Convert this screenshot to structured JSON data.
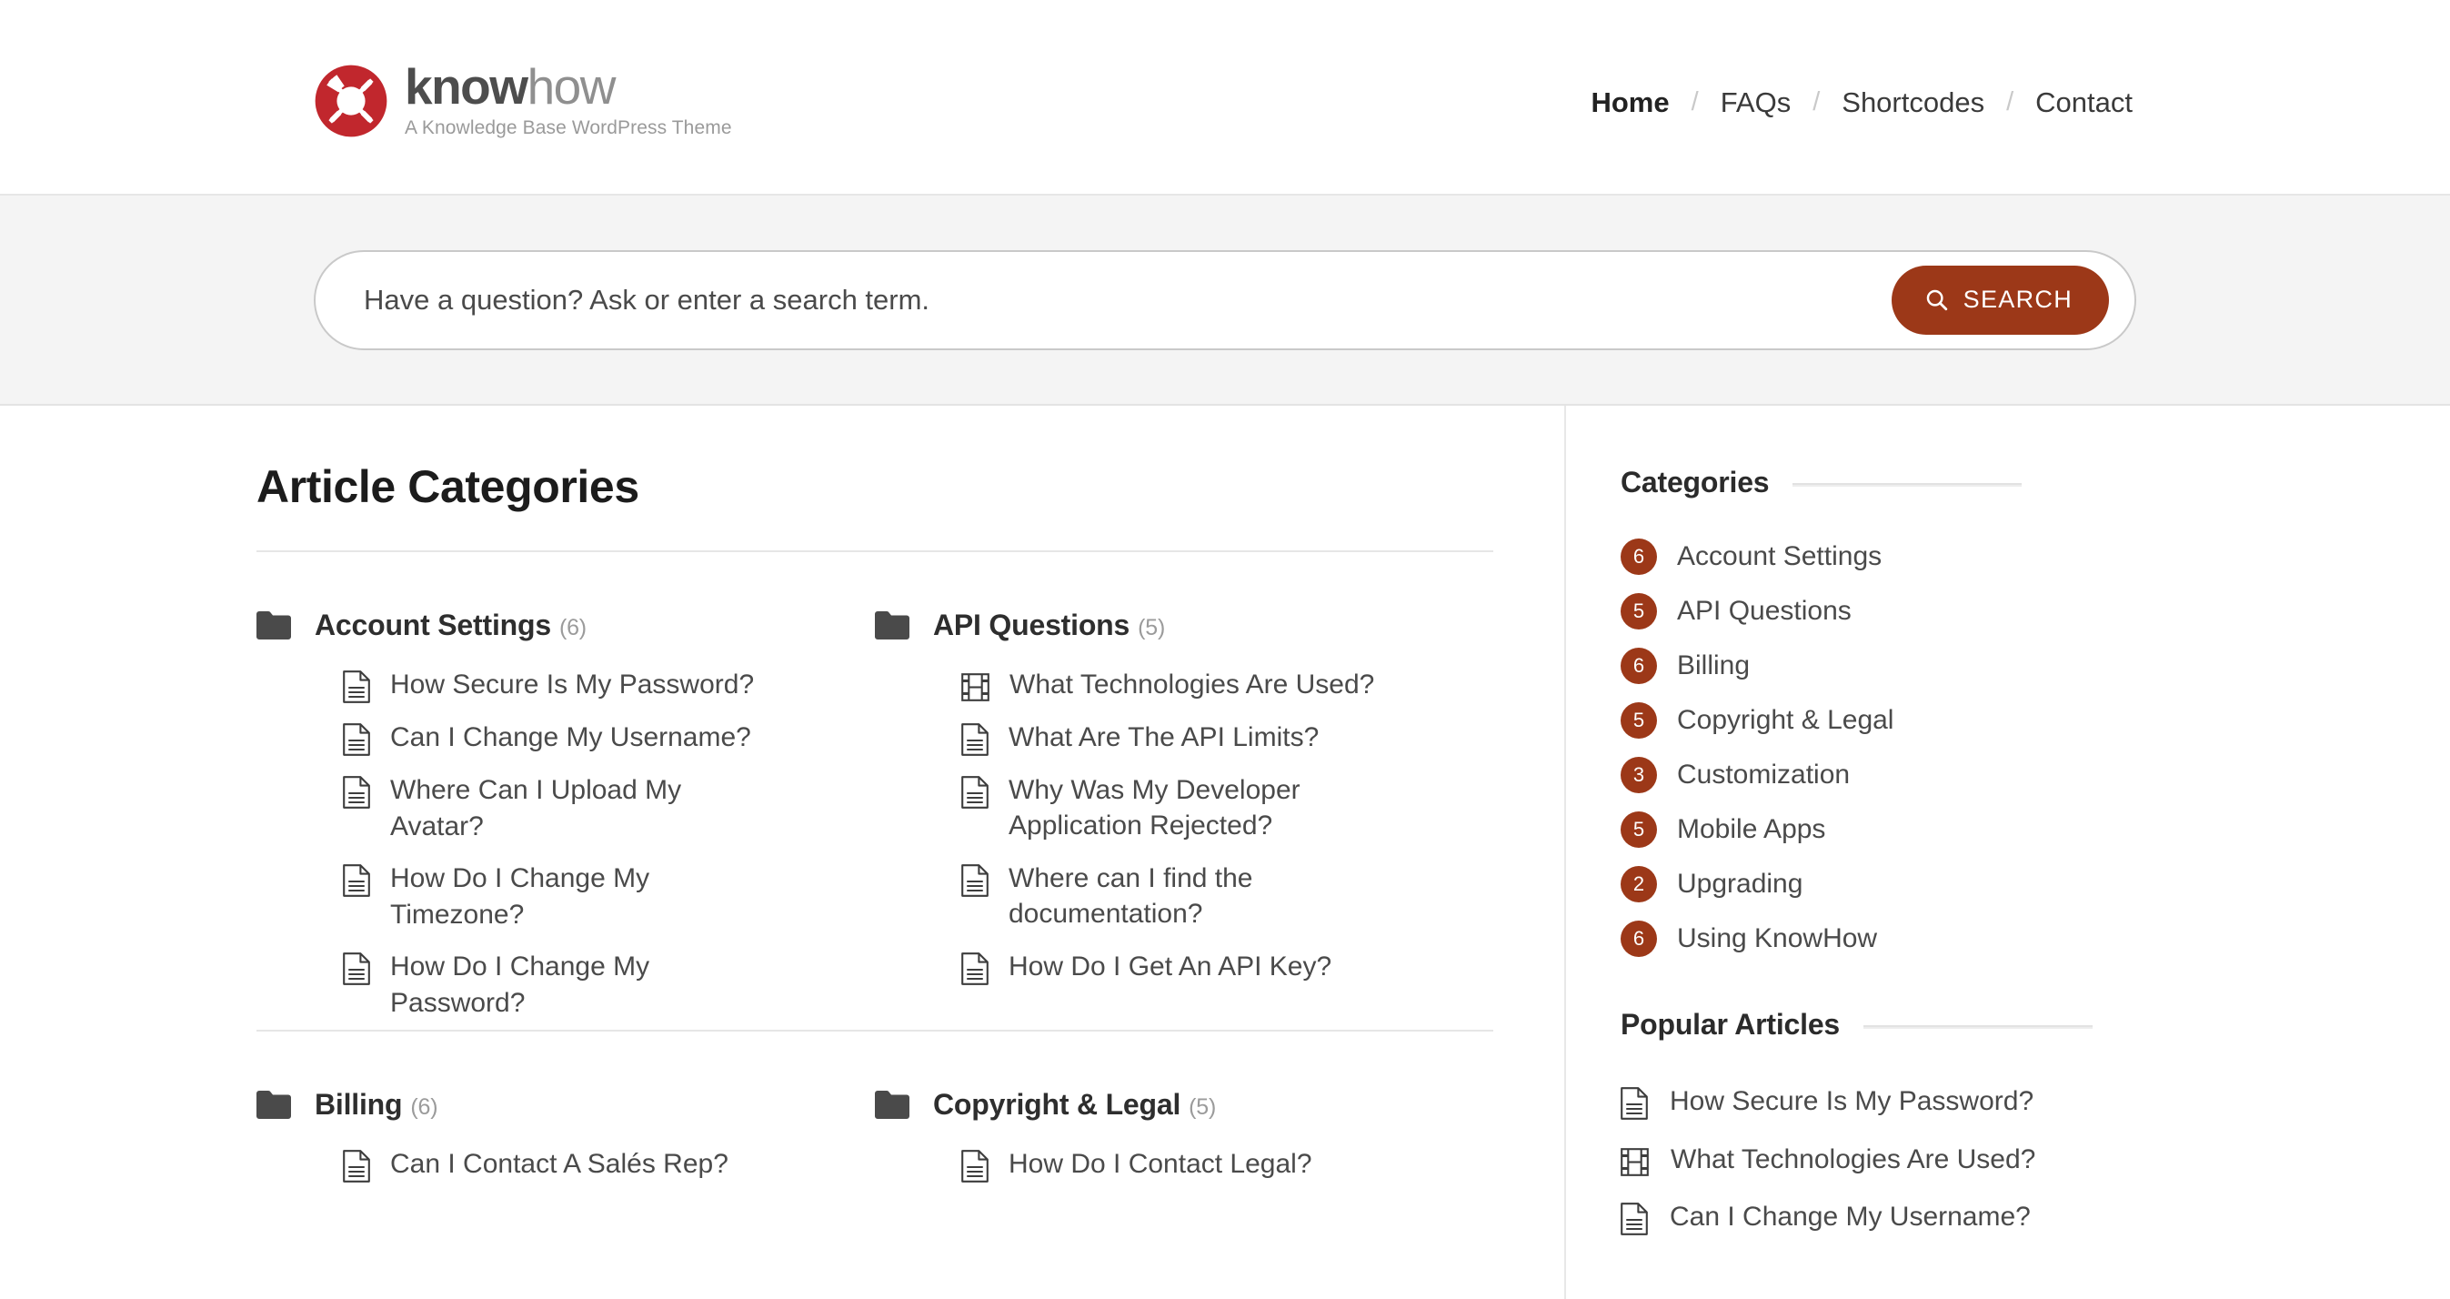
{
  "header": {
    "logo": {
      "icon": "lifebuoy-icon",
      "word_bold": "know",
      "word_light": "how",
      "tagline": "A Knowledge Base WordPress Theme",
      "brand_red": "#c1272d"
    },
    "nav": {
      "separator": "/",
      "items": [
        {
          "label": "Home",
          "current": true
        },
        {
          "label": "FAQs",
          "current": false
        },
        {
          "label": "Shortcodes",
          "current": false
        },
        {
          "label": "Contact",
          "current": false
        }
      ]
    }
  },
  "search": {
    "placeholder": "Have a question? Ask or enter a search term.",
    "value": "",
    "button_label": "SEARCH",
    "button_icon": "search-icon",
    "button_color": "#9c3818",
    "band_background": "#f4f4f4"
  },
  "main": {
    "title": "Article Categories",
    "categories": [
      {
        "name": "Account Settings",
        "count": "(6)",
        "icon": "folder-icon",
        "articles": [
          {
            "title": "How Secure Is My Password?",
            "icon": "document-icon"
          },
          {
            "title": "Can I Change My Username?",
            "icon": "document-icon"
          },
          {
            "title": "Where Can I Upload My Avatar?",
            "icon": "document-icon"
          },
          {
            "title": "How Do I Change My Timezone?",
            "icon": "document-icon"
          },
          {
            "title": "How Do I Change My Password?",
            "icon": "document-icon"
          }
        ]
      },
      {
        "name": "API Questions",
        "count": "(5)",
        "icon": "folder-icon",
        "articles": [
          {
            "title": "What Technologies Are Used?",
            "icon": "video-icon"
          },
          {
            "title": "What Are The API Limits?",
            "icon": "document-icon"
          },
          {
            "title": "Why Was My Developer Application Rejected?",
            "icon": "document-icon"
          },
          {
            "title": "Where can I find the documentation?",
            "icon": "document-icon"
          },
          {
            "title": "How Do I Get An API Key?",
            "icon": "document-icon"
          }
        ]
      },
      {
        "name": "Billing",
        "count": "(6)",
        "icon": "folder-icon",
        "articles": [
          {
            "title": "Can I Contact A Salés Rep?",
            "icon": "document-icon"
          }
        ]
      },
      {
        "name": "Copyright & Legal",
        "count": "(5)",
        "icon": "folder-icon",
        "articles": [
          {
            "title": "How Do I Contact Legal?",
            "icon": "document-icon"
          }
        ]
      }
    ]
  },
  "sidebar": {
    "categories_widget": {
      "title": "Categories",
      "items": [
        {
          "count": "6",
          "label": "Account Settings"
        },
        {
          "count": "5",
          "label": "API Questions"
        },
        {
          "count": "6",
          "label": "Billing"
        },
        {
          "count": "5",
          "label": "Copyright & Legal"
        },
        {
          "count": "3",
          "label": "Customization"
        },
        {
          "count": "5",
          "label": "Mobile Apps"
        },
        {
          "count": "2",
          "label": "Upgrading"
        },
        {
          "count": "6",
          "label": "Using KnowHow"
        }
      ],
      "badge_color": "#9c3818"
    },
    "popular_widget": {
      "title": "Popular Articles",
      "items": [
        {
          "title": "How Secure Is My Password?",
          "icon": "document-icon"
        },
        {
          "title": "What Technologies Are Used?",
          "icon": "video-icon"
        },
        {
          "title": "Can I Change My Username?",
          "icon": "document-icon"
        }
      ]
    }
  }
}
